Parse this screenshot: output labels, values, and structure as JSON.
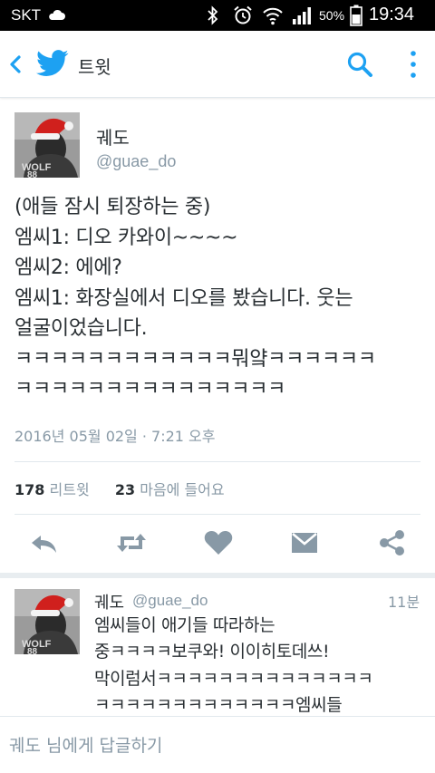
{
  "status_bar": {
    "carrier": "SKT",
    "battery_percent": "50%",
    "time": "19:34"
  },
  "app_bar": {
    "title": "트윗"
  },
  "tweet": {
    "author_name": "궤도",
    "author_handle": "@guae_do",
    "lines": [
      "(애들 잠시 퇴장하는 중)",
      "엠씨1: 디오 카와이~~~~",
      "엠씨2: 에에?",
      "엠씨1: 화장실에서 디오를 봤습니다. 웃는",
      "얼굴이었습니다.",
      "ㅋㅋㅋㅋㅋㅋㅋㅋㅋㅋㅋㅋ뭐얔ㅋㅋㅋㅋㅋㅋ",
      "ㅋㅋㅋㅋㅋㅋㅋㅋㅋㅋㅋㅋㅋㅋㅋ"
    ],
    "timestamp": "2016년 05월 02일 · 7:21 오후",
    "retweet_count": "178",
    "retweet_label": "리트윗",
    "like_count": "23",
    "like_label": "마음에 들어요"
  },
  "actions": [
    "reply-icon",
    "retweet-icon",
    "heart-icon",
    "direct-message-icon",
    "share-icon"
  ],
  "reply": {
    "author_name": "궤도",
    "author_handle": "@guae_do",
    "time": "11분",
    "lines": [
      "엠씨들이 애기들 따라하는",
      "중ㅋㅋㅋㅋ보쿠와! 이이히토데쓰!",
      "막이럼서ㅋㅋㅋㅋㅋㅋㅋㅋㅋㅋㅋㅋㅋㅋ",
      "ㅋㅋㅋㅋㅋㅋㅋㅋㅋㅋㅋㅋㅋ엠씨들"
    ]
  },
  "reply_bar": {
    "placeholder": "궤도 님에게 답글하기"
  },
  "colors": {
    "twitter_blue": "#1da1f2",
    "action_gray": "#8899a6",
    "text": "#292f33",
    "santa_red": "#d0201d"
  }
}
